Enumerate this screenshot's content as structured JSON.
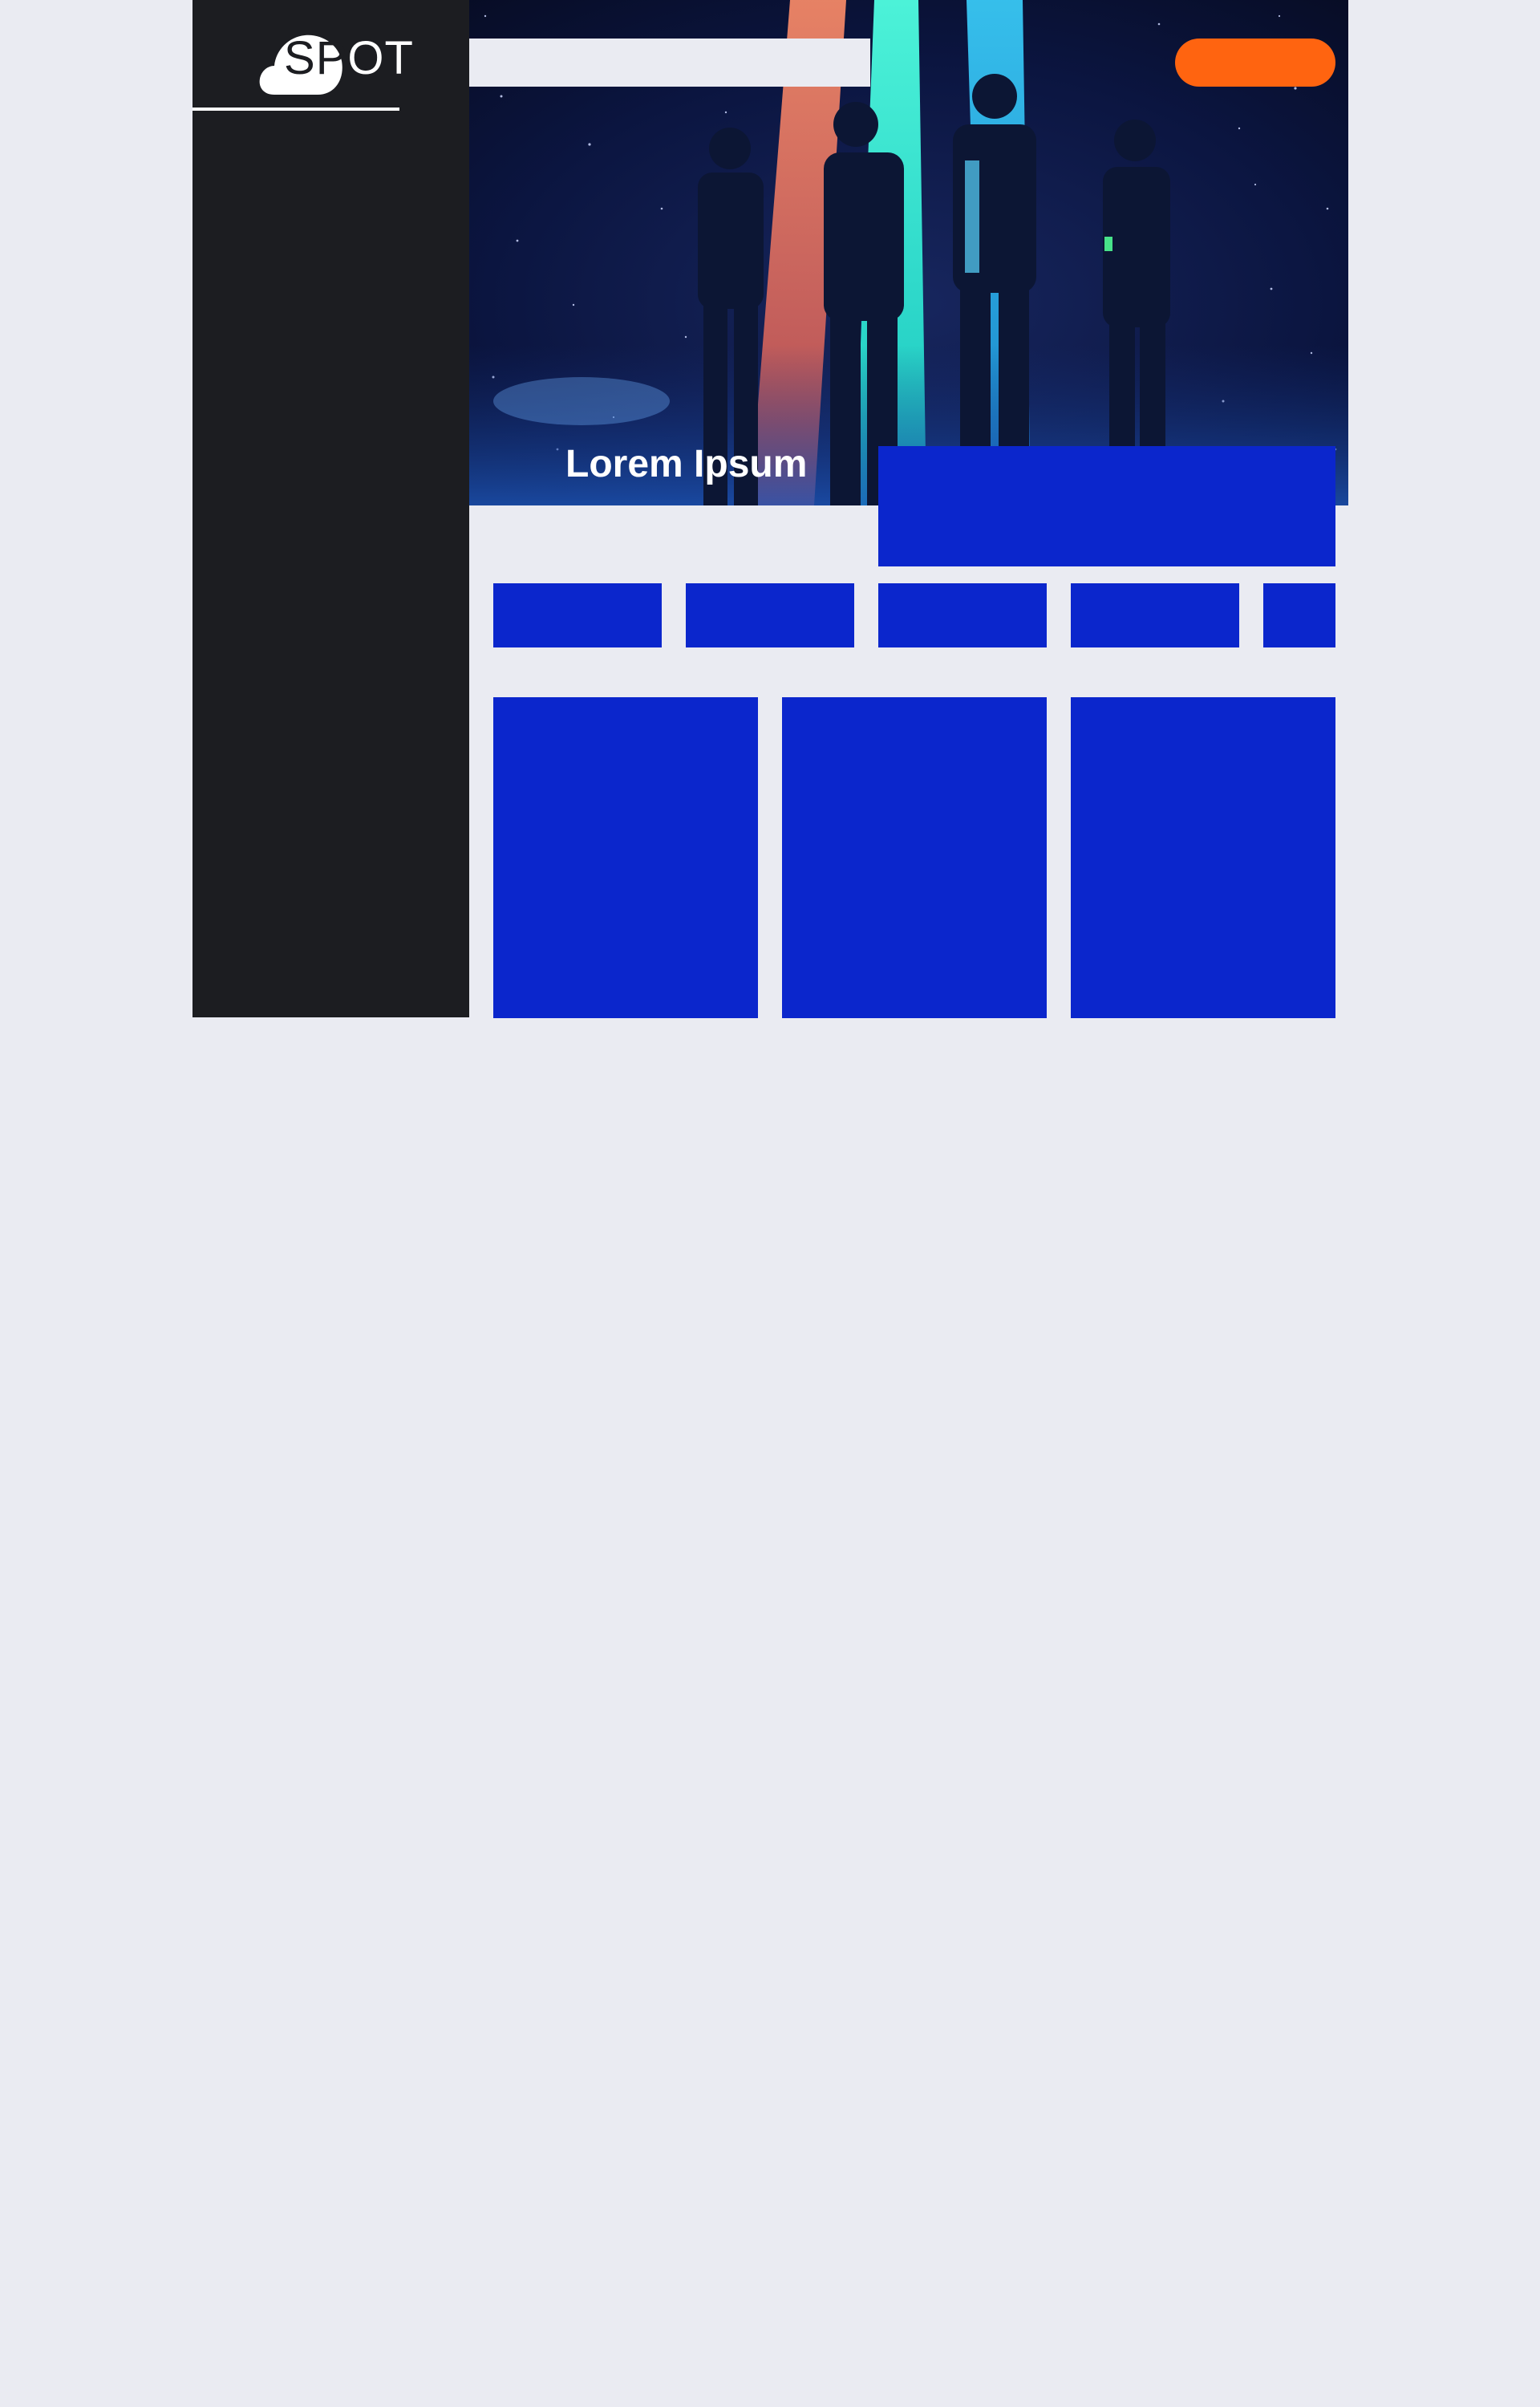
{
  "brand": {
    "logo_text_parts": [
      "S",
      "P",
      "OT"
    ],
    "logo_text": "SPOT"
  },
  "header": {
    "search": {
      "value": "",
      "placeholder": ""
    },
    "cta_label": ""
  },
  "hero": {
    "title": "Lorem Ipsum"
  },
  "feature_panel": {
    "text": ""
  },
  "categories": [
    "",
    "",
    "",
    "",
    ""
  ],
  "cards": [
    "",
    "",
    ""
  ],
  "colors": {
    "page_background": "#eaebf2",
    "sidebar": "#1c1d21",
    "accent_blue": "#0b26cc",
    "cta_orange": "#ff6410",
    "hero_sky": "#0a1336"
  }
}
